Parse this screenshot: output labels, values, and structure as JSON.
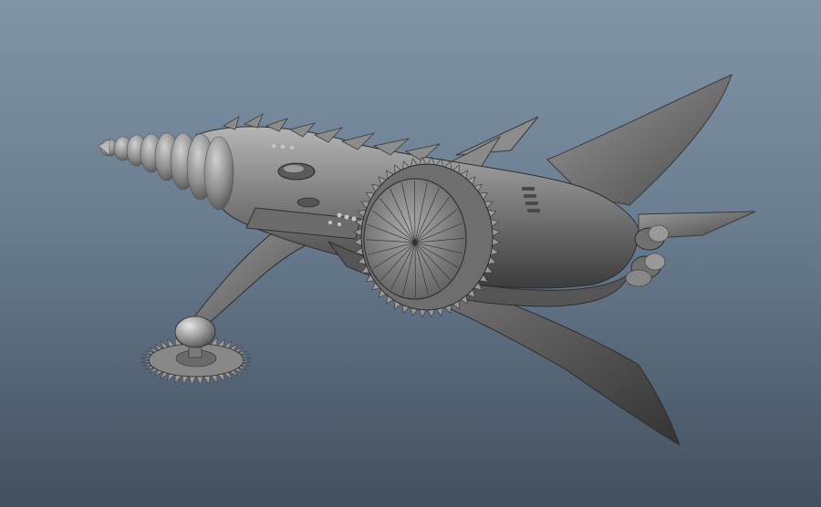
{
  "scene": {
    "subject": "drill-spaceship-model",
    "background_top": "#8194a8",
    "background_bottom": "#43505e",
    "model_base_color": "#7d7d7d",
    "model_highlight_color": "#b3b3b3",
    "model_shadow_color": "#3e3e3e"
  }
}
